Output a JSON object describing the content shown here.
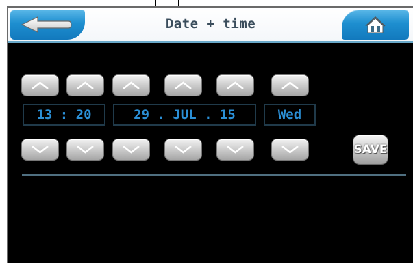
{
  "header": {
    "title": "Date + time",
    "back_button": {
      "icon": "back-arrow-icon"
    },
    "home_button": {
      "icon": "home-icon"
    }
  },
  "fields": {
    "time": "13 : 20",
    "date": "29 . JUL . 15",
    "weekday": "Wed"
  },
  "controls": {
    "up_icon": "chevron-up-icon",
    "down_icon": "chevron-down-icon",
    "save_label": "SAVE"
  },
  "colors": {
    "accent": "#1e8fd0",
    "value_text": "#2b8fd6",
    "background": "#000000"
  }
}
